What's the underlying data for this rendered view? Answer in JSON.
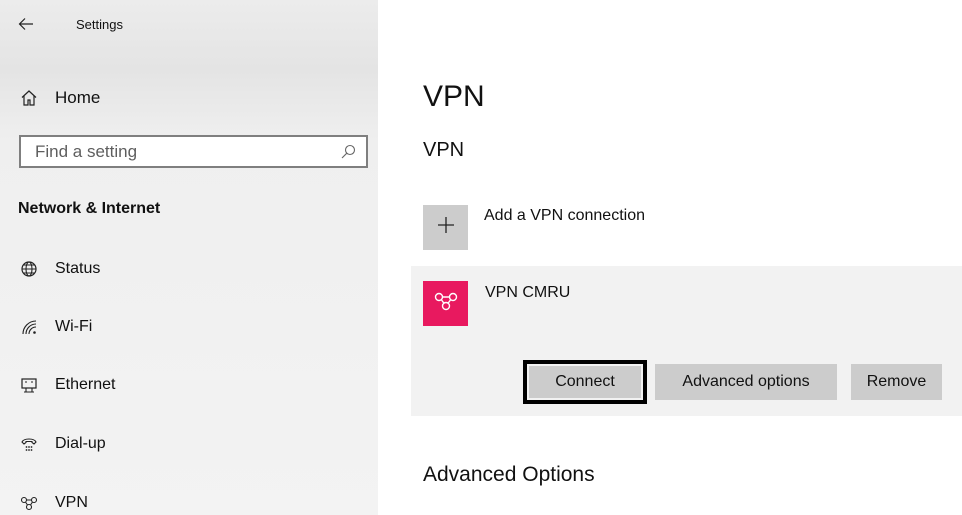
{
  "window": {
    "title": "Settings"
  },
  "sidebar": {
    "home_label": "Home",
    "search": {
      "placeholder": "Find a setting",
      "value": ""
    },
    "section_title": "Network & Internet",
    "items": [
      {
        "label": "Status",
        "icon": "globe-icon"
      },
      {
        "label": "Wi-Fi",
        "icon": "wifi-icon"
      },
      {
        "label": "Ethernet",
        "icon": "ethernet-icon"
      },
      {
        "label": "Dial-up",
        "icon": "dialup-icon"
      },
      {
        "label": "VPN",
        "icon": "vpn-icon"
      }
    ]
  },
  "main": {
    "page_title": "VPN",
    "section_title": "VPN",
    "add_label": "Add a VPN connection",
    "connection": {
      "name": "VPN CMRU",
      "icon": "vpn-icon",
      "tile_color": "#e8195f",
      "buttons": {
        "connect": "Connect",
        "advanced": "Advanced options",
        "remove": "Remove"
      }
    },
    "advanced_title": "Advanced Options"
  },
  "colors": {
    "sidebar_bg": "#efefef",
    "tile_gray": "#cccccc",
    "card_bg": "#f2f2f2",
    "vpn_accent": "#e8195f"
  }
}
